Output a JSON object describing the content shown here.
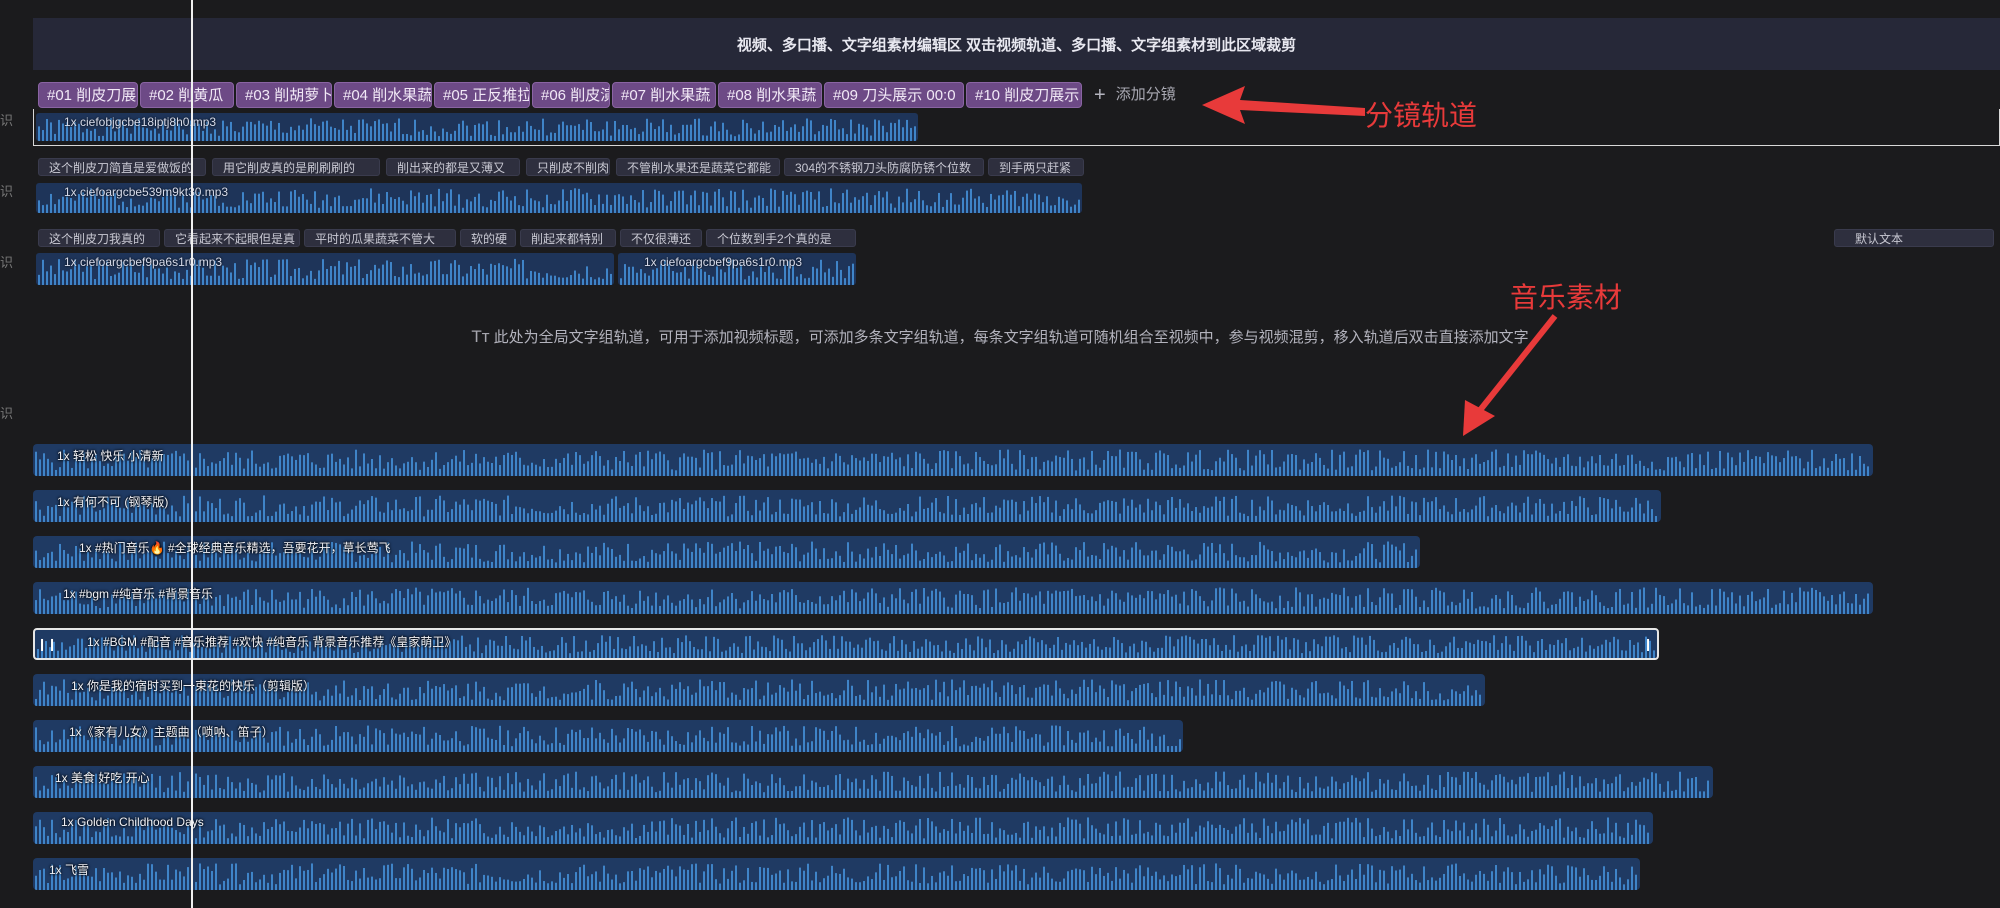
{
  "banner": "视频、多口播、文字组素材编辑区   双击视频轨道、多口播、文字组素材到此区域裁剪",
  "gutter": {
    "label": "识"
  },
  "shots": [
    {
      "label": "#01 削皮刀展"
    },
    {
      "label": "#02 削黄瓜"
    },
    {
      "label": "#03 削胡萝卜"
    },
    {
      "label": "#04 削水果蔬"
    },
    {
      "label": "#05 正反推拉"
    },
    {
      "label": "#06 削皮演"
    },
    {
      "label": "#07 削水果蔬"
    },
    {
      "label": "#08 削水果蔬"
    },
    {
      "label": "#09 刀头展示 00:0"
    },
    {
      "label": "#10 削皮刀展示"
    }
  ],
  "add_shot": "添加分镜",
  "voice_tracks": [
    {
      "file": "1x ciefobjgcbe18iptj8h0.mp3"
    },
    {
      "file": "1x ciefoargcbe539m9kt30.mp3"
    },
    {
      "file": "1x ciefoargcbef9pa6s1r0.mp3"
    },
    {
      "file": "1x ciefoargcbef9pa6s1r0.mp3"
    }
  ],
  "subtitles_row1": [
    "这个削皮刀简直是爱做饭的",
    "用它削皮真的是刷刷刷的",
    "削出来的都是又薄又",
    "只削皮不削肉",
    "不管削水果还是蔬菜它都能",
    "304的不锈钢刀头防腐防锈个位数",
    "到手两只赶紧"
  ],
  "subtitles_row2": [
    "这个削皮刀我真的",
    "它看起来不起眼但是真",
    "平时的瓜果蔬菜不管大",
    "软的硬",
    "削起来都特别",
    "不仅很薄还",
    "个位数到手2个真的是"
  ],
  "default_text": "默认文本",
  "hint": "此处为全局文字组轨道，可用于添加视频标题，可添加多条文字组轨道，每条文字组轨道可随机组合至视频中，参与视频混剪，移入轨道后双击直接添加文字",
  "music_tracks": [
    {
      "label": "1x 轻松 快乐 小清新"
    },
    {
      "label": "1x 有何不可 (钢琴版)"
    },
    {
      "label": "1x #热门音乐🔥 #全球经典音乐精选，吾要花开，草长莺飞"
    },
    {
      "label": "1x #bgm #纯音乐 #背景音乐"
    },
    {
      "label": "1x #BGM #配音 #音乐推荐 #欢快 #纯音乐 背景音乐推荐《皇家萌卫》"
    },
    {
      "label": "1x 你是我的宿时买到一束花的快乐（剪辑版）"
    },
    {
      "label": "1x《家有儿女》主题曲（唢呐、笛子）"
    },
    {
      "label": "1x 美食 好吃 开心"
    },
    {
      "label": "1x Golden Childhood Days"
    },
    {
      "label": "1x 飞雪"
    }
  ],
  "annotations": {
    "storyboard_track": "分镜轨道",
    "music_material": "音乐素材"
  },
  "colors": {
    "shot": "#6d4a86",
    "track": "#1f3a63",
    "wave": "#3f84c8",
    "annotation": "#e83a3a"
  }
}
